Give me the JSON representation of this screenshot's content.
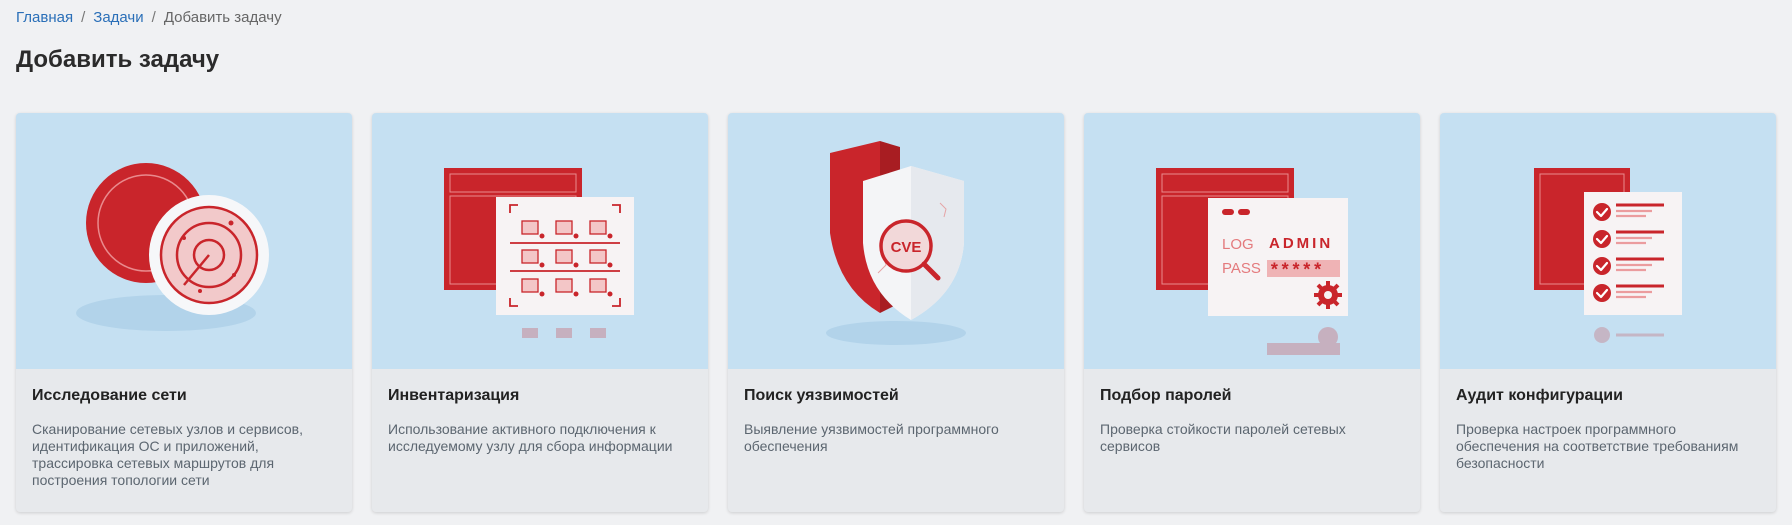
{
  "breadcrumb": {
    "home": "Главная",
    "tasks": "Задачи",
    "current": "Добавить задачу",
    "separator": "/"
  },
  "page_title": "Добавить задачу",
  "colors": {
    "accent_red": "#c9252b",
    "card_art_bg": "#c5e0f2",
    "link": "#2a6fb8"
  },
  "cards": [
    {
      "icon": "radar-icon",
      "title": "Исследование сети",
      "description": "Сканирование сетевых узлов и сервисов, идентификация ОС и приложений, трассировка сетевых маршрутов для построения топологии сети"
    },
    {
      "icon": "inventory-grid-icon",
      "title": "Инвентаризация",
      "description": "Использование активного подключения к исследуемому узлу для сбора информации"
    },
    {
      "icon": "shield-cve-icon",
      "title": "Поиск уязвимостей",
      "description": "Выявление уязвимостей программного обеспечения",
      "art_label": "CVE"
    },
    {
      "icon": "password-login-icon",
      "title": "Подбор паролей",
      "description": "Проверка стойкости паролей сетевых сервисов",
      "art_log": "LOG",
      "art_user": "ADMIN",
      "art_pass": "PASS",
      "art_mask": "*****"
    },
    {
      "icon": "checklist-icon",
      "title": "Аудит конфигурации",
      "description": "Проверка настроек программного обеспечения на соответствие требованиям безопасности"
    }
  ]
}
